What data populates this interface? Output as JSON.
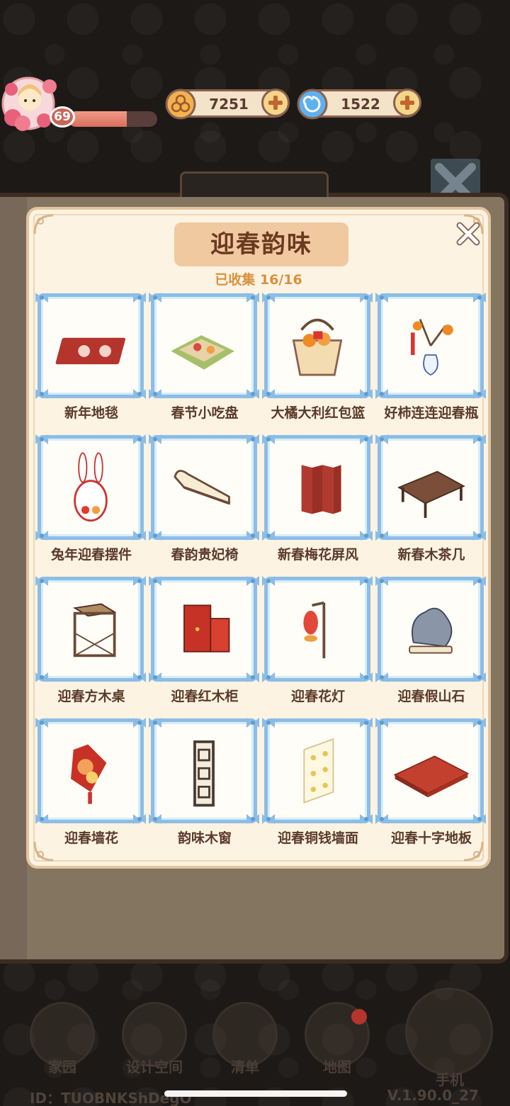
{
  "hud": {
    "level": "69",
    "xp_fraction": 0.66,
    "coins": "7251",
    "gems": "1522"
  },
  "panel": {
    "title": "迎春韵味",
    "collected": "已收集 16/16"
  },
  "items": [
    {
      "name": "新年地毯",
      "icon": "red-rug-icon"
    },
    {
      "name": "春节小吃盘",
      "icon": "snack-tray-icon"
    },
    {
      "name": "大橘大利红包篮",
      "icon": "orange-basket-icon"
    },
    {
      "name": "好柿连连迎春瓶",
      "icon": "persimmon-vase-icon"
    },
    {
      "name": "兔年迎春摆件",
      "icon": "rabbit-ornament-icon"
    },
    {
      "name": "春韵贵妃椅",
      "icon": "chaise-lounge-icon"
    },
    {
      "name": "新春梅花屏风",
      "icon": "folding-screen-icon"
    },
    {
      "name": "新春木茶几",
      "icon": "wood-tea-table-icon"
    },
    {
      "name": "迎春方木桌",
      "icon": "square-wood-table-icon"
    },
    {
      "name": "迎春红木柜",
      "icon": "red-cabinet-icon"
    },
    {
      "name": "迎春花灯",
      "icon": "flower-lantern-icon"
    },
    {
      "name": "迎春假山石",
      "icon": "rockery-stone-icon"
    },
    {
      "name": "迎春墙花",
      "icon": "wall-flower-icon"
    },
    {
      "name": "韵味木窗",
      "icon": "lattice-window-icon"
    },
    {
      "name": "迎春铜钱墙面",
      "icon": "coin-wallpaper-icon"
    },
    {
      "name": "迎春十字地板",
      "icon": "cross-floor-icon"
    }
  ],
  "nav": {
    "home": "家园",
    "design": "设计空间",
    "list": "清单",
    "map": "地图",
    "phone": "手机"
  },
  "footer": {
    "user_id": "ID：TUOBNKShDegO",
    "version": "V.1.90.0_27"
  },
  "colors": {
    "frame_blue": "#8bbde6",
    "panel_bg": "#fdf3e2",
    "title_bg": "#f1c9a0",
    "collected_text": "#d8913e"
  }
}
